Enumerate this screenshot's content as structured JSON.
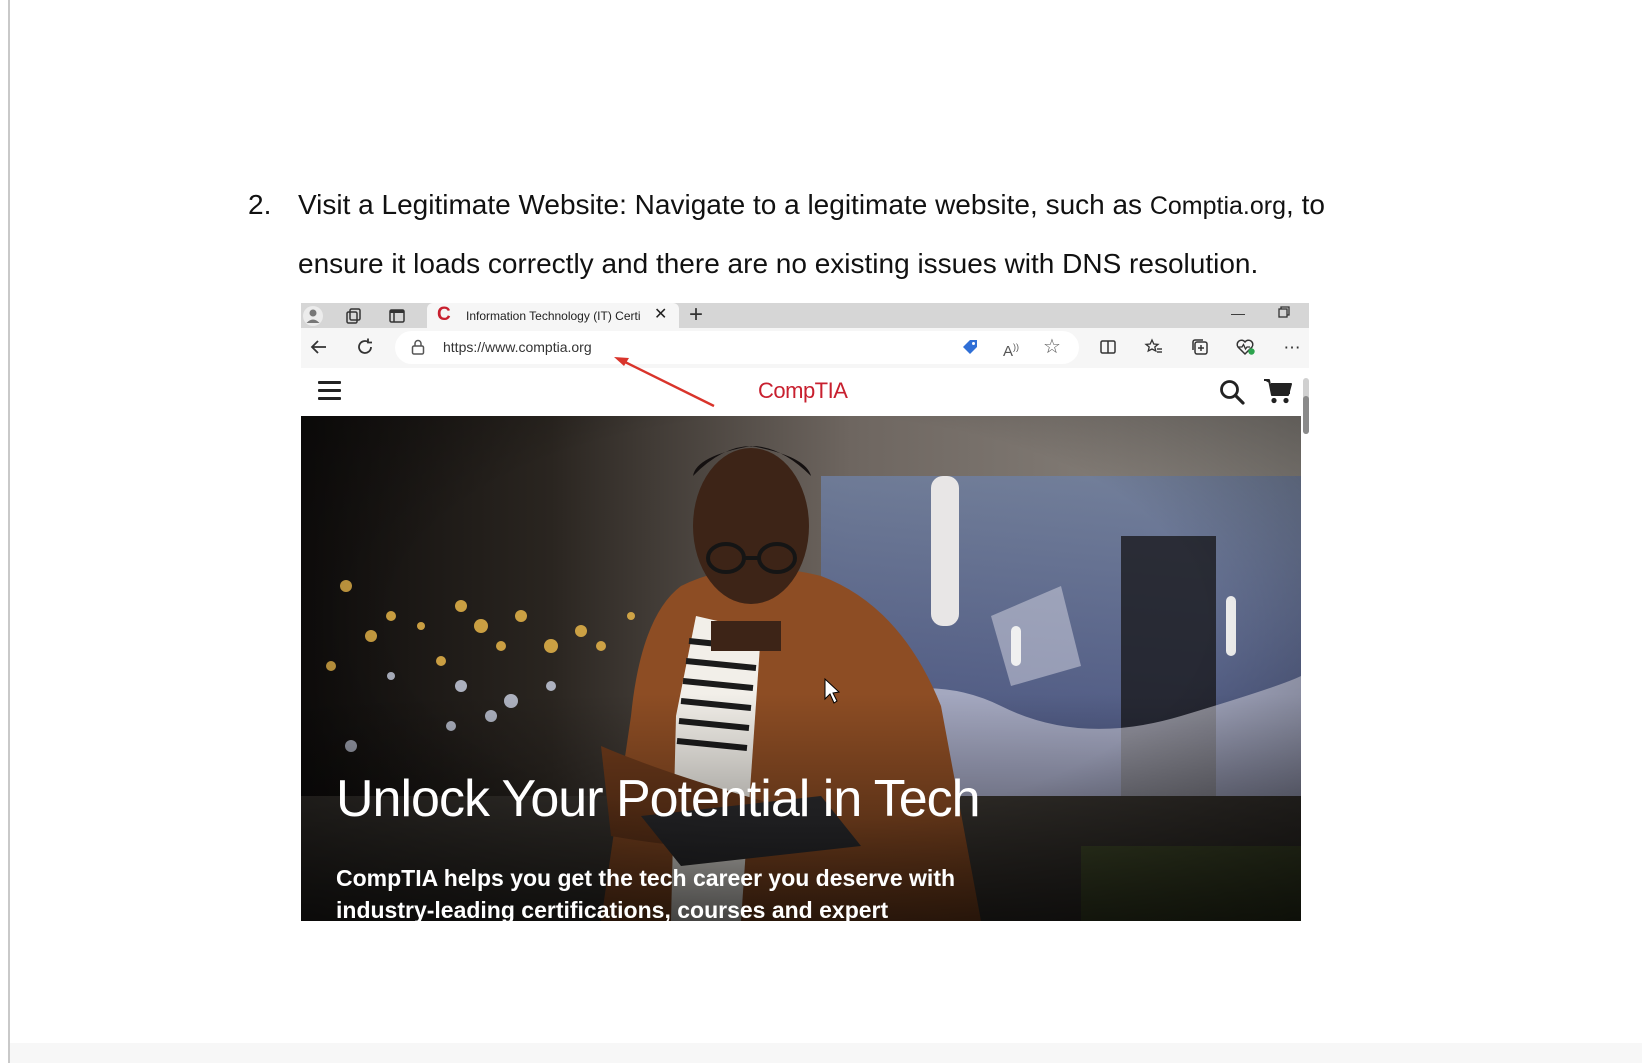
{
  "document": {
    "step_number": "2.",
    "step_text_before": "Visit a Legitimate Website: Navigate to a legitimate website, such as ",
    "step_site": "Comptia.org",
    "step_text_after": ", to ensure it loads correctly and there are no existing issues with DNS resolution."
  },
  "browser": {
    "tab_favicon": "C",
    "tab_title": "Information Technology (IT) Certi",
    "url": "https://www.comptia.org",
    "icons": {
      "profile": "profile-icon",
      "workspaces": "workspaces-icon",
      "tab_actions": "tab-actions-icon",
      "close_tab": "close-icon",
      "new_tab": "plus-icon",
      "minimize": "minimize-icon",
      "restore": "restore-icon",
      "back": "back-arrow-icon",
      "refresh": "refresh-icon",
      "lock": "lock-icon",
      "coupon": "tag-icon",
      "read_aloud": "read-aloud-icon",
      "favorite": "star-icon",
      "split_screen": "split-screen-icon",
      "favorites": "favorites-icon",
      "collections": "collections-icon",
      "browser_essentials": "heart-pulse-icon",
      "more": "more-icon"
    }
  },
  "site": {
    "logo": "CompTIA",
    "hero_title": "Unlock Your Potential in Tech",
    "hero_subtitle": "CompTIA helps you get the tech career you deserve with industry-leading certifications, courses and expert"
  },
  "colors": {
    "brand_red": "#c8202f",
    "annotation_arrow": "#d9342b"
  }
}
